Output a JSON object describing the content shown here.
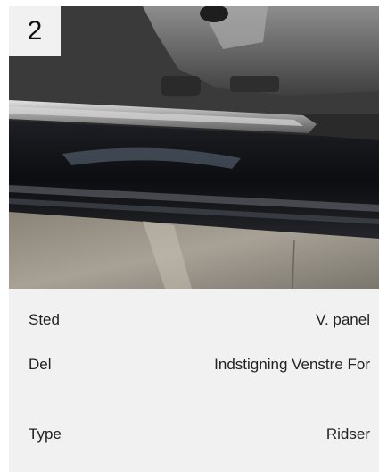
{
  "card": {
    "badge": "2",
    "photo_alt": "Indstigning Venstre For",
    "details": [
      {
        "label": "Sted",
        "value": "V. panel"
      },
      {
        "label": "Del",
        "value": "Indstigning Venstre For"
      },
      {
        "label": "Type",
        "value": "Ridser"
      }
    ]
  },
  "colors": {
    "card_background": "#f1f1f1",
    "text": "#222222"
  }
}
